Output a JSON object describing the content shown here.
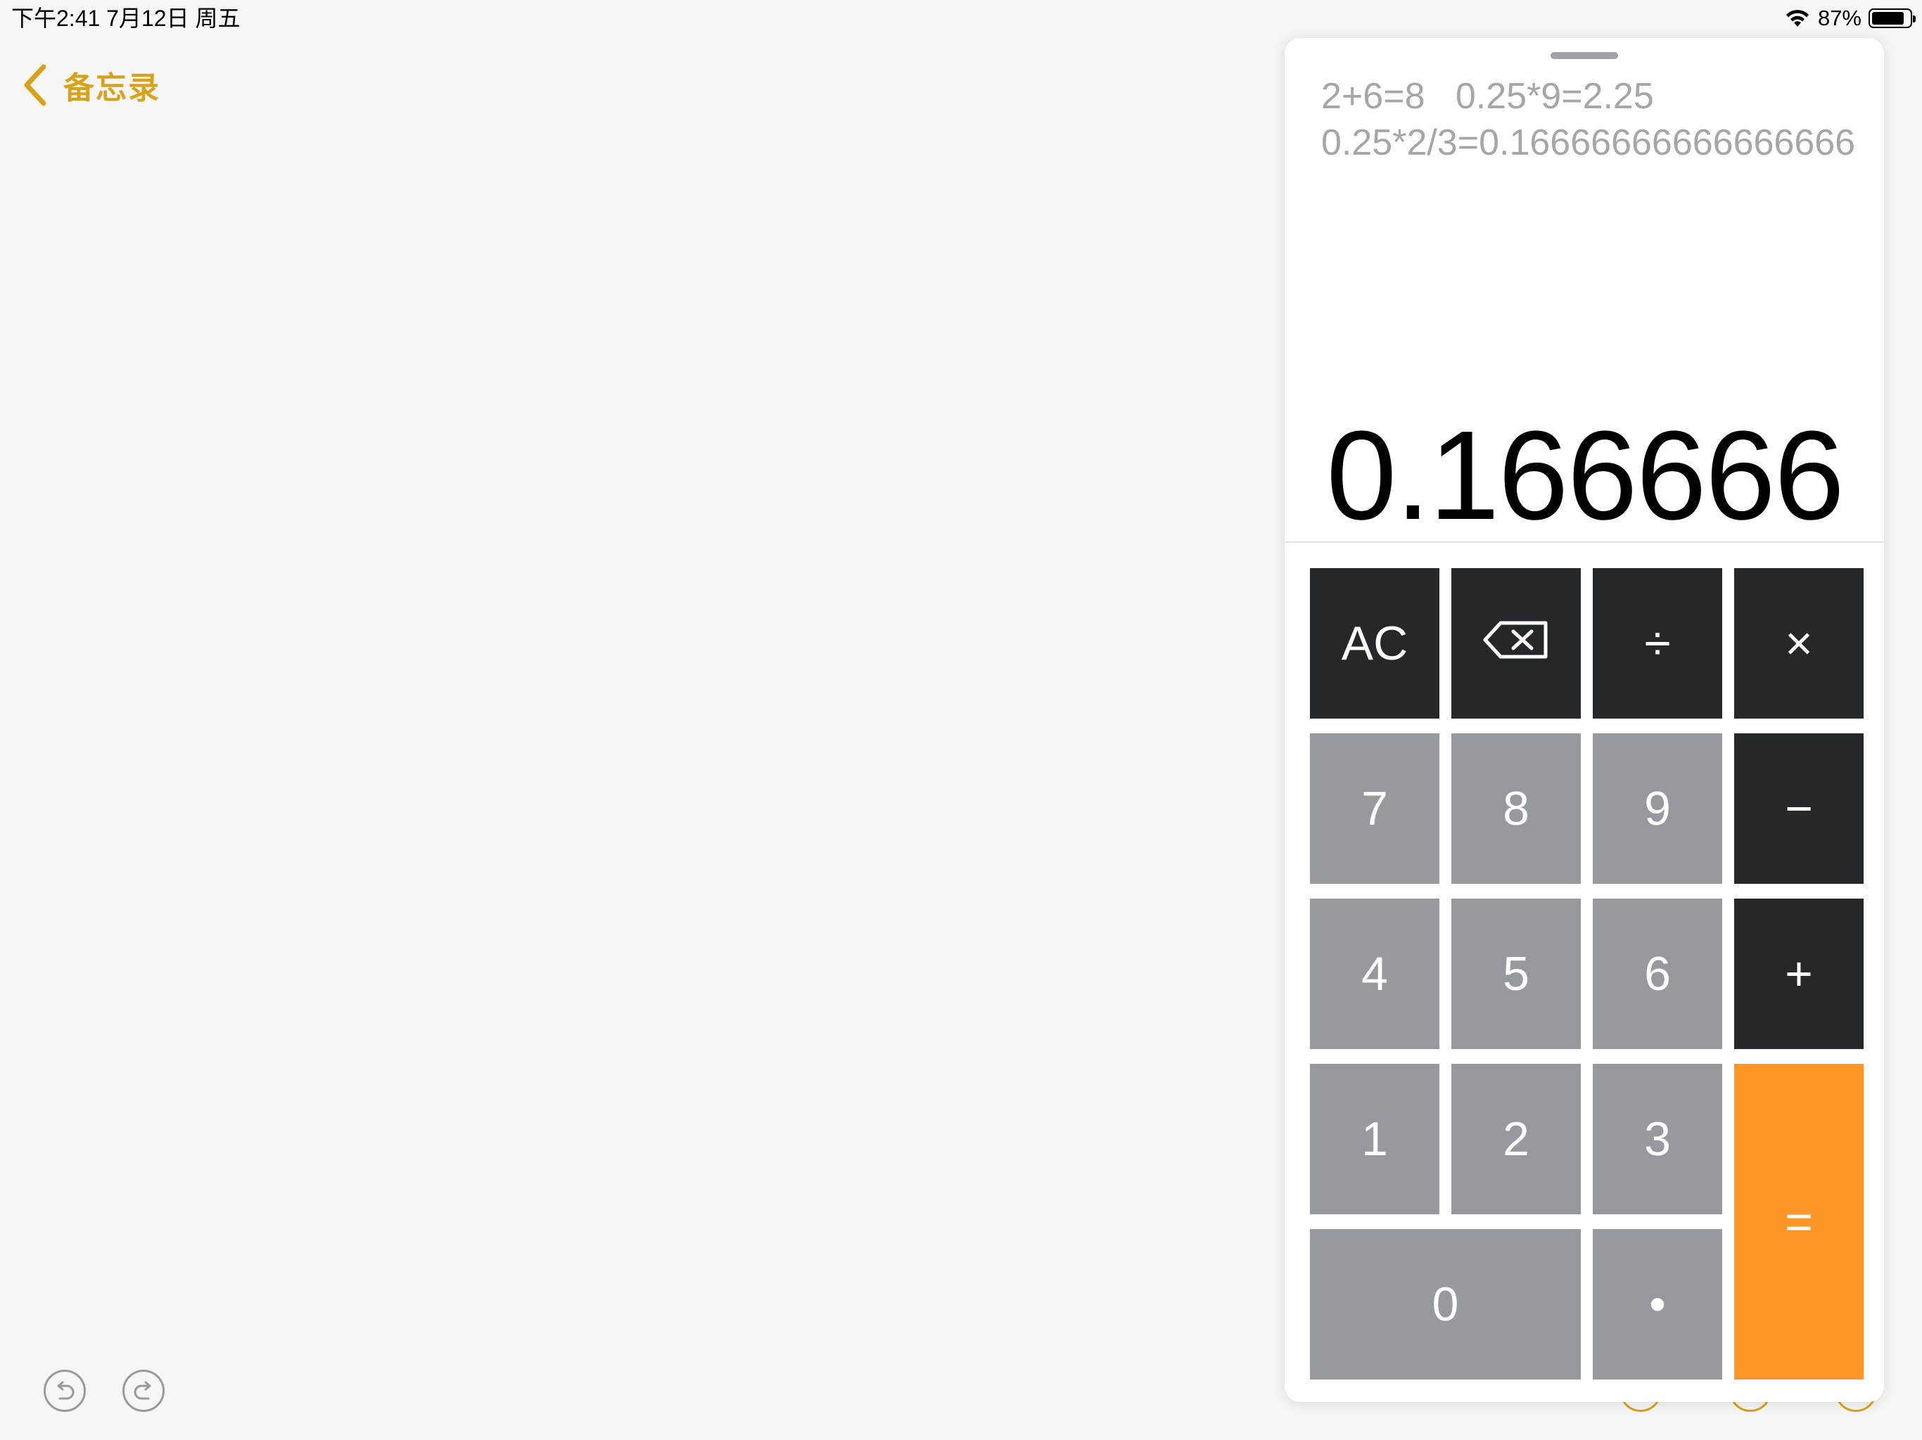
{
  "status_bar": {
    "time_date": "下午2:41   7月12日 周五",
    "battery_percent": "87%",
    "battery_level": 0.87,
    "icons": [
      "wifi-icon",
      "battery-icon"
    ]
  },
  "notes": {
    "back_label": "备忘录",
    "back_icon": "chevron-left-icon",
    "accent_color": "#d9a21c",
    "undo_icon": "undo-icon",
    "redo_icon": "redo-icon"
  },
  "calculator": {
    "history": {
      "line1": "2+6=8   0.25*9=2.25",
      "line2": "0.25*2/3=0.16666666666666666"
    },
    "display": "0.166666",
    "keys": {
      "clear": "AC",
      "delete": "⌫",
      "divide": "÷",
      "multiply": "×",
      "seven": "7",
      "eight": "8",
      "nine": "9",
      "minus": "−",
      "four": "4",
      "five": "5",
      "six": "6",
      "plus": "+",
      "one": "1",
      "two": "2",
      "three": "3",
      "equals": "=",
      "zero": "0",
      "decimal": "•"
    },
    "colors": {
      "operator_key": "#26272b",
      "digit_key": "#98999f",
      "equals_key": "#fc9728"
    }
  }
}
